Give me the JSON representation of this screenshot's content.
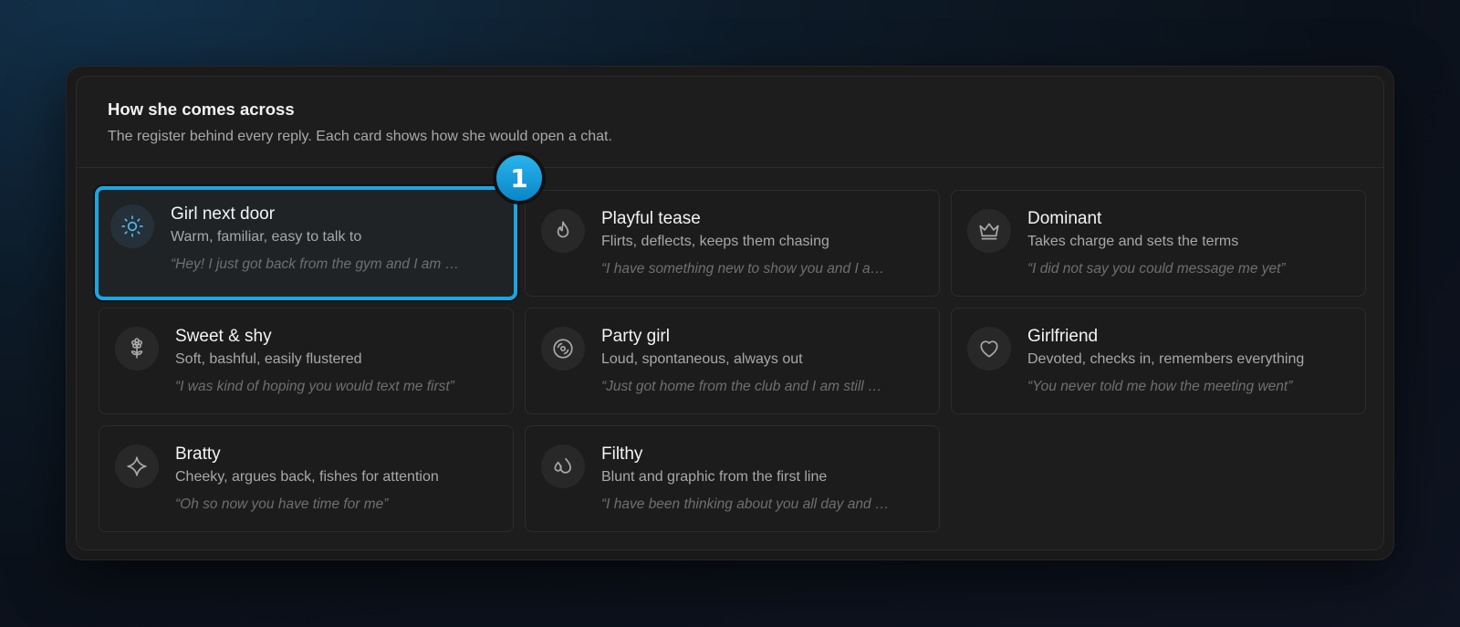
{
  "section": {
    "title": "How she comes across",
    "subtitle": "The register behind every reply. Each card shows how she would open a chat."
  },
  "step_badge": "1",
  "colors": {
    "accent": "#1aa6e3",
    "background": "#1d1d1d",
    "card": "#1c1c1c"
  },
  "cards": [
    {
      "name": "Girl next door",
      "desc": "Warm, familiar, easy to talk to",
      "quote": "“Hey! I just got back from the gym and I am …",
      "icon": "sun-icon",
      "selected": true
    },
    {
      "name": "Playful tease",
      "desc": "Flirts, deflects, keeps them chasing",
      "quote": "“I have something new to show you and I a…",
      "icon": "flame-icon",
      "selected": false
    },
    {
      "name": "Dominant",
      "desc": "Takes charge and sets the terms",
      "quote": "“I did not say you could message me yet”",
      "icon": "crown-icon",
      "selected": false
    },
    {
      "name": "Sweet & shy",
      "desc": "Soft, bashful, easily flustered",
      "quote": "“I was kind of hoping you would text me first”",
      "icon": "flower-icon",
      "selected": false
    },
    {
      "name": "Party girl",
      "desc": "Loud, spontaneous, always out",
      "quote": "“Just got home from the club and I am still …",
      "icon": "disc-icon",
      "selected": false
    },
    {
      "name": "Girlfriend",
      "desc": "Devoted, checks in, remembers everything",
      "quote": "“You never told me how the meeting went”",
      "icon": "heart-icon",
      "selected": false
    },
    {
      "name": "Bratty",
      "desc": "Cheeky, argues back, fishes for attention",
      "quote": "“Oh so now you have time for me”",
      "icon": "sparkle-icon",
      "selected": false
    },
    {
      "name": "Filthy",
      "desc": "Blunt and graphic from the first line",
      "quote": "“I have been thinking about you all day and …",
      "icon": "droplets-icon",
      "selected": false
    }
  ]
}
